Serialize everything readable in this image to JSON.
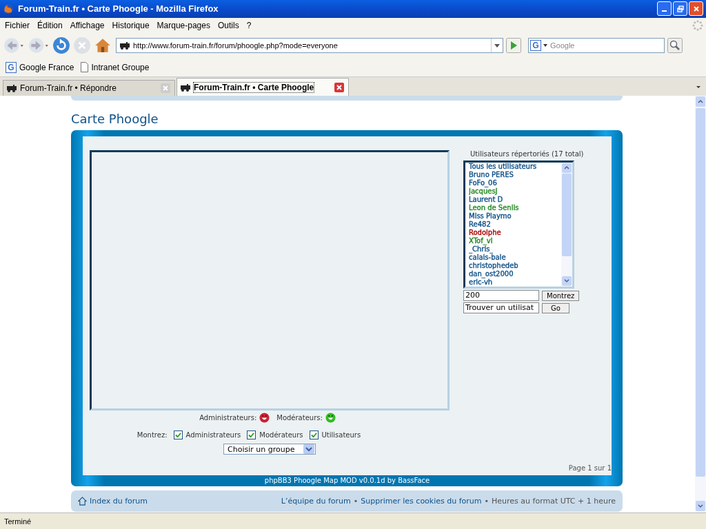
{
  "window": {
    "title": "Forum-Train.fr • Carte Phoogle - Mozilla Firefox"
  },
  "menu": [
    "Fichier",
    "Édition",
    "Affichage",
    "Historique",
    "Marque-pages",
    "Outils",
    "?"
  ],
  "toolbar": {
    "url": "http://www.forum-train.fr/forum/phoogle.php?mode=everyone",
    "search_engine_letter": "G",
    "search_placeholder": "Google"
  },
  "bookmarks": [
    {
      "kind": "engine",
      "icon_letter": "G",
      "label": "Google France"
    },
    {
      "kind": "page",
      "label": "Intranet Groupe"
    }
  ],
  "tabs": [
    {
      "label": "Forum-Train.fr • Répondre",
      "selected": false
    },
    {
      "label": "Forum-Train.fr • Carte Phoogle",
      "selected": true
    }
  ],
  "page": {
    "heading": "Carte Phoogle",
    "legend": [
      {
        "label": "Administrateurs:",
        "color": "#cc2233"
      },
      {
        "label": "Modérateurs:",
        "color": "#33bb22"
      }
    ],
    "filter_label": "Montrez:",
    "filters": [
      {
        "label": "Administrateurs",
        "checked": true
      },
      {
        "label": "Modérateurs",
        "checked": true
      },
      {
        "label": "Utilisateurs",
        "checked": true
      }
    ],
    "group_select": "Choisir un groupe",
    "users_title": "Utilisateurs répertoriés (17 total)",
    "users": [
      {
        "name": "Tous les utilisateurs",
        "color": "#105289"
      },
      {
        "name": "Bruno PERES",
        "color": "#105289"
      },
      {
        "name": "FoFo_06",
        "color": "#105289"
      },
      {
        "name": "JacquesJ",
        "color": "#228822"
      },
      {
        "name": "Laurent D",
        "color": "#105289"
      },
      {
        "name": "Leon de Senlis",
        "color": "#228822"
      },
      {
        "name": "Miss Playmo",
        "color": "#105289"
      },
      {
        "name": "Re482",
        "color": "#105289"
      },
      {
        "name": "Rodolphe",
        "color": "#aa0000"
      },
      {
        "name": "XTof_vl",
        "color": "#228822"
      },
      {
        "name": "_Chris_",
        "color": "#105289"
      },
      {
        "name": "calais-bale",
        "color": "#105289"
      },
      {
        "name": "christophedeb",
        "color": "#105289"
      },
      {
        "name": "dan_ost2000",
        "color": "#105289"
      },
      {
        "name": "eric-vh",
        "color": "#105289"
      }
    ],
    "count_value": "200",
    "count_button": "Montrez",
    "find_value": "Trouver un utilisat",
    "find_button": "Go",
    "pagination": "Page 1 sur 1",
    "credit": "phpBB3 Phoogle Map MOD v0.0.1d by BassFace",
    "footer": {
      "index": "Index du forum",
      "items": [
        {
          "kind": "link",
          "text": "L’équipe du forum"
        },
        {
          "kind": "separator",
          "text": "•"
        },
        {
          "kind": "link",
          "text": "Supprimer les cookies du forum"
        },
        {
          "kind": "separator",
          "text": "•"
        },
        {
          "kind": "note",
          "text": "Heures au format UTC + 1 heure"
        }
      ]
    }
  },
  "status_bar": "Terminé"
}
